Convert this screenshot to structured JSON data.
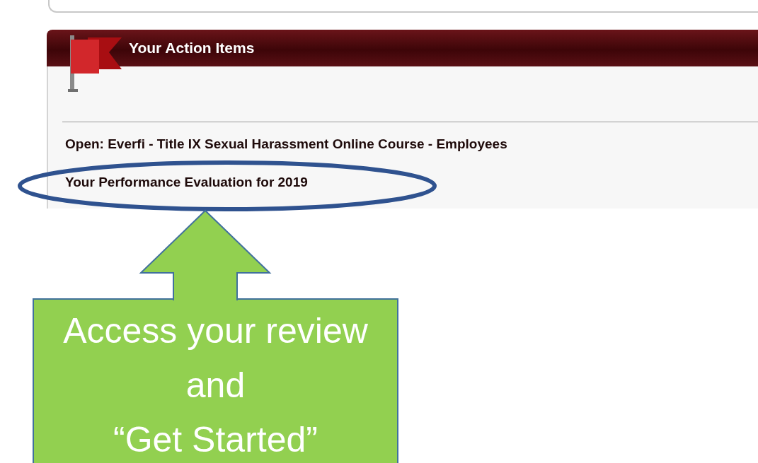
{
  "panel": {
    "title": "Your Action Items"
  },
  "action_items": [
    {
      "label": "Open: Everfi - Title IX Sexual Harassment Online Course - Employees"
    },
    {
      "label": "Your Performance Evaluation for 2019"
    }
  ],
  "callout": {
    "lines": [
      "Access your review",
      "and",
      "“Get Started”"
    ]
  }
}
